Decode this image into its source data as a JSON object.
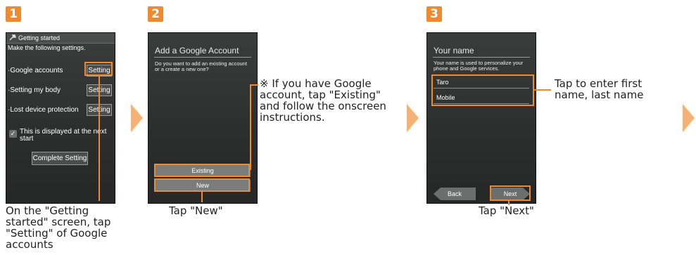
{
  "steps": [
    "1",
    "2",
    "3"
  ],
  "screen1": {
    "title": "Getting started",
    "intro": "Make the following settings.",
    "rows": [
      {
        "label": "·Google accounts",
        "button": "Setting"
      },
      {
        "label": "·Setting my body",
        "button": "Setting"
      },
      {
        "label": "·Lost device protection",
        "button": "Setting"
      }
    ],
    "checkbox_label": "This is displayed at the next start",
    "complete_button": "Complete Setting",
    "caption": "On the \"Getting started\" screen, tap \"Setting\" of Google accounts"
  },
  "screen2": {
    "title": "Add a Google Account",
    "text": "Do you want to add an existing account or a create a new one?",
    "existing_button": "Existing",
    "new_button": "New",
    "caption": "Tap \"New\"",
    "note": "※ If you have Google account, tap \"Existing\" and follow the onscreen instructions."
  },
  "screen3": {
    "title": "Your name",
    "text": "Your name is used to personalize your phone and Google services.",
    "first_name": "Taro",
    "last_name": "Mobile",
    "back_button": "Back",
    "next_button": "Next",
    "caption": "Tap \"Next\"",
    "note": "Tap to enter first name, last name"
  },
  "colors": {
    "accent": "#ef8a2f",
    "arrow": "#f4b277",
    "screen_bg": "#2e2f2f"
  }
}
